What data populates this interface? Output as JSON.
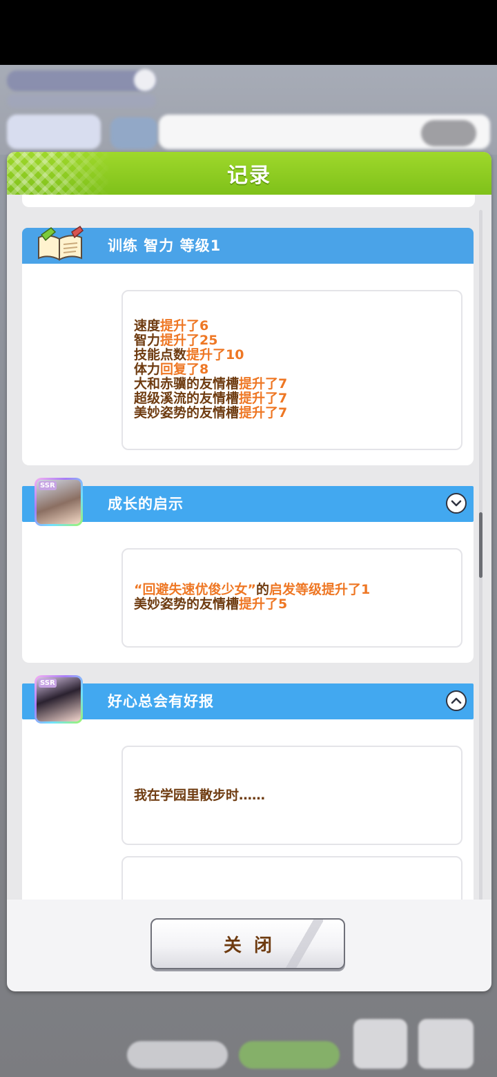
{
  "dialog": {
    "title": "记录"
  },
  "entries": [
    {
      "icon": "book-quill-icon",
      "title": "训练 智力 等级1",
      "lines": [
        {
          "subject": "速度",
          "effect": "提升了6"
        },
        {
          "subject": "智力",
          "effect": "提升了25"
        },
        {
          "subject": "技能点数",
          "effect": "提升了10"
        },
        {
          "subject": "体力",
          "effect": "回复了8"
        },
        {
          "subject": "大和赤骥的友情槽",
          "effect": "提升了7"
        },
        {
          "subject": "超级溪流的友情槽",
          "effect": "提升了7"
        },
        {
          "subject": "美妙姿势的友情槽",
          "effect": "提升了7"
        }
      ]
    },
    {
      "icon": "ssr-support-card-avatar",
      "rarity": "SSR",
      "title": "成长的启示",
      "toggle_icon": "chevron-down-icon",
      "line1": {
        "quoted": "“回避失速优俊少女”",
        "mid": "的",
        "effect": "启发等级提升了1"
      },
      "line2": {
        "subject": "美妙姿势的友情槽",
        "effect": "提升了5"
      }
    },
    {
      "icon": "ssr-support-card-avatar",
      "rarity": "SSR",
      "title": "好心总会有好报",
      "toggle_icon": "chevron-up-icon",
      "text": "我在学园里散步时……"
    }
  ],
  "footer": {
    "close_label": "关闭"
  },
  "colors": {
    "header_green": "#8bcb1e",
    "entry_blue": "#4aa3e8",
    "text_brown": "#6e3b10",
    "highlight_orange": "#ee7724"
  }
}
